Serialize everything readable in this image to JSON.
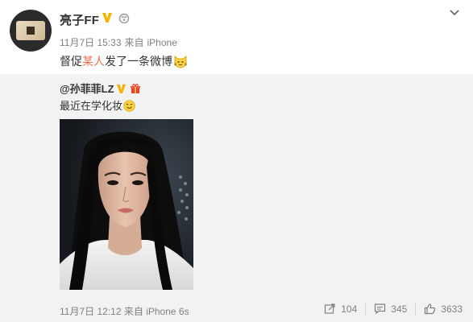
{
  "post": {
    "author": "亮子FF",
    "date": "11月7日 15:33",
    "source_prefix": "来自",
    "source": "iPhone",
    "text_before": "督促",
    "text_highlight": "某人",
    "text_after": "发了一条微博",
    "emoji": "cat-emoji"
  },
  "repost": {
    "author": "@孙菲菲LZ",
    "text": "最近在学化妆",
    "emoji": "smile-emoji",
    "date": "11月7日 12:12",
    "source_prefix": "来自",
    "source": "iPhone 6s",
    "actions": {
      "forward_count": "104",
      "comment_count": "345",
      "like_count": "3633"
    }
  },
  "colors": {
    "highlight": "#eb7350",
    "meta": "#808080",
    "repost_bg": "#f2f2f2",
    "verified": "#f4b400"
  }
}
